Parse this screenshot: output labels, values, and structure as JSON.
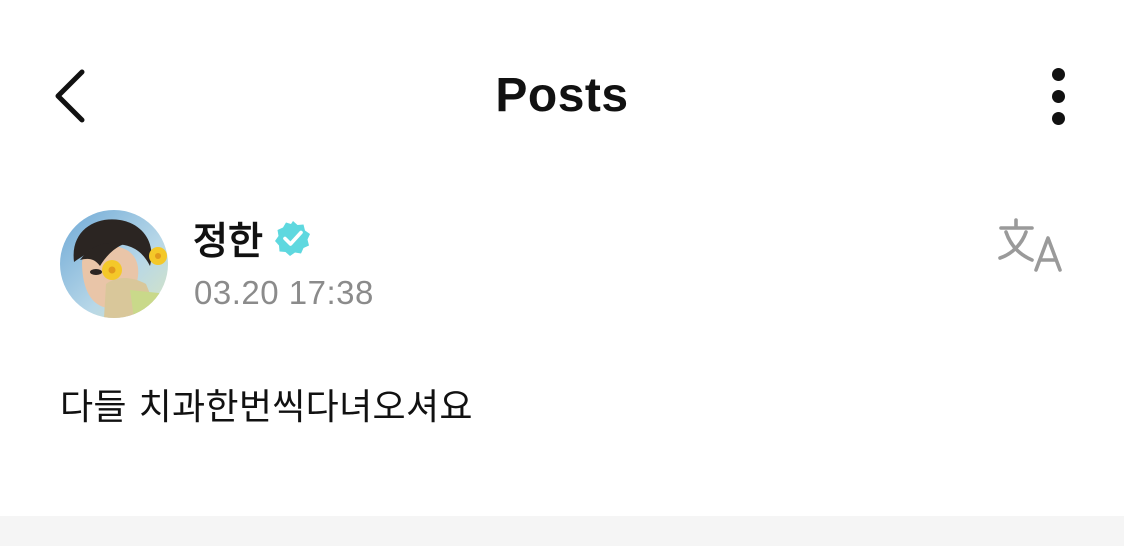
{
  "header": {
    "title": "Posts",
    "back_icon": "chevron-left-icon",
    "more_icon": "more-vertical-icon"
  },
  "post": {
    "author_name": "정한",
    "verified_icon": "verified-badge-icon",
    "timestamp": "03.20 17:38",
    "translate_icon": "translate-icon",
    "text": "다들 치과한번씩다녀오셔요"
  },
  "colors": {
    "text": "#111111",
    "secondary_text": "#8b8b8b",
    "verified": "#5ed8df",
    "translate_icon": "#9a9a9a",
    "divider": "#f5f5f5"
  }
}
